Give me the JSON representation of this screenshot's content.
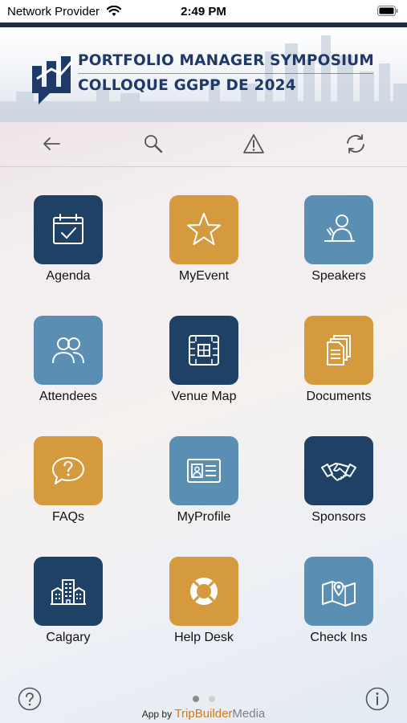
{
  "status_bar": {
    "carrier": "Network Provider",
    "time": "2:49 PM",
    "wifi_icon": "wifi-icon",
    "battery_icon": "battery-icon"
  },
  "banner": {
    "title_line_1": "PORTFOLIO MANAGER SYMPOSIUM",
    "title_line_2": "COLLOQUE GGPP DE 2024",
    "brand_color": "#1f3a68"
  },
  "toolbar": {
    "icons": [
      "back-arrow-icon",
      "search-icon",
      "alert-icon",
      "refresh-icon"
    ]
  },
  "grid": {
    "tiles": [
      {
        "label": "Agenda",
        "icon": "calendar-check-icon",
        "color": "#1f4166"
      },
      {
        "label": "MyEvent",
        "icon": "star-icon",
        "color": "#d49a3d"
      },
      {
        "label": "Speakers",
        "icon": "speaker-podium-icon",
        "color": "#5a8fb3"
      },
      {
        "label": "Attendees",
        "icon": "people-icon",
        "color": "#5a8fb3"
      },
      {
        "label": "Venue Map",
        "icon": "floor-plan-icon",
        "color": "#1f4166"
      },
      {
        "label": "Documents",
        "icon": "documents-icon",
        "color": "#d49a3d"
      },
      {
        "label": "FAQs",
        "icon": "question-bubble-icon",
        "color": "#d49a3d"
      },
      {
        "label": "MyProfile",
        "icon": "id-card-icon",
        "color": "#5a8fb3"
      },
      {
        "label": "Sponsors",
        "icon": "handshake-icon",
        "color": "#1f4166"
      },
      {
        "label": "Calgary",
        "icon": "city-buildings-icon",
        "color": "#1f4166"
      },
      {
        "label": "Help Desk",
        "icon": "lifebuoy-icon",
        "color": "#d49a3d"
      },
      {
        "label": "Check Ins",
        "icon": "map-pin-icon",
        "color": "#5a8fb3"
      }
    ]
  },
  "footer": {
    "help_icon": "help-circle-icon",
    "info_icon": "info-circle-icon",
    "page_indicator": {
      "current": 1,
      "total": 2
    },
    "credit_prefix": "App by",
    "credit_brand_a": "TripBuilder",
    "credit_brand_b": "Media"
  }
}
